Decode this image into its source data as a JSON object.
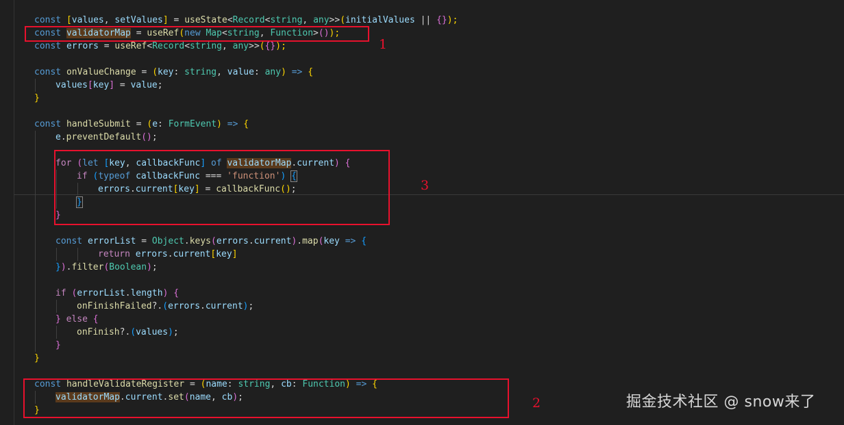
{
  "code_lines": [
    {
      "indent": 0,
      "tokens": [
        {
          "t": "const ",
          "c": "kw"
        },
        {
          "t": "[",
          "c": "p1"
        },
        {
          "t": "values",
          "c": "var"
        },
        {
          "t": ", ",
          "c": "op"
        },
        {
          "t": "setValues",
          "c": "var"
        },
        {
          "t": "]",
          "c": "p1"
        },
        {
          "t": " = ",
          "c": "op"
        },
        {
          "t": "useState",
          "c": "fn"
        },
        {
          "t": "<",
          "c": "op"
        },
        {
          "t": "Record",
          "c": "type"
        },
        {
          "t": "<",
          "c": "op"
        },
        {
          "t": "string",
          "c": "type"
        },
        {
          "t": ", ",
          "c": "op"
        },
        {
          "t": "any",
          "c": "type"
        },
        {
          "t": ">>",
          "c": "op"
        },
        {
          "t": "(",
          "c": "p1"
        },
        {
          "t": "initialValues",
          "c": "var"
        },
        {
          "t": " || ",
          "c": "op"
        },
        {
          "t": "{}",
          "c": "p2"
        },
        {
          "t": ");",
          "c": "p1"
        }
      ]
    },
    {
      "indent": 0,
      "tokens": [
        {
          "t": "const ",
          "c": "kw"
        },
        {
          "t": "validatorMap",
          "c": "var hl"
        },
        {
          "t": " = ",
          "c": "op"
        },
        {
          "t": "useRef",
          "c": "fn"
        },
        {
          "t": "(",
          "c": "p1"
        },
        {
          "t": "new ",
          "c": "kw"
        },
        {
          "t": "Map",
          "c": "type"
        },
        {
          "t": "<",
          "c": "op"
        },
        {
          "t": "string",
          "c": "type"
        },
        {
          "t": ", ",
          "c": "op"
        },
        {
          "t": "Function",
          "c": "type"
        },
        {
          "t": ">",
          "c": "op"
        },
        {
          "t": "()",
          "c": "p2"
        },
        {
          "t": ");",
          "c": "p1"
        }
      ]
    },
    {
      "indent": 0,
      "tokens": [
        {
          "t": "const ",
          "c": "kw"
        },
        {
          "t": "errors",
          "c": "var"
        },
        {
          "t": " = ",
          "c": "op"
        },
        {
          "t": "useRef",
          "c": "fn"
        },
        {
          "t": "<",
          "c": "op"
        },
        {
          "t": "Record",
          "c": "type"
        },
        {
          "t": "<",
          "c": "op"
        },
        {
          "t": "string",
          "c": "type"
        },
        {
          "t": ", ",
          "c": "op"
        },
        {
          "t": "any",
          "c": "type"
        },
        {
          "t": ">>",
          "c": "op"
        },
        {
          "t": "(",
          "c": "p1"
        },
        {
          "t": "{}",
          "c": "p2"
        },
        {
          "t": ");",
          "c": "p1"
        }
      ]
    },
    {
      "indent": 0,
      "tokens": []
    },
    {
      "indent": 0,
      "tokens": [
        {
          "t": "const ",
          "c": "kw"
        },
        {
          "t": "onValueChange",
          "c": "fn"
        },
        {
          "t": " = ",
          "c": "op"
        },
        {
          "t": "(",
          "c": "p1"
        },
        {
          "t": "key",
          "c": "var"
        },
        {
          "t": ": ",
          "c": "op"
        },
        {
          "t": "string",
          "c": "type"
        },
        {
          "t": ", ",
          "c": "op"
        },
        {
          "t": "value",
          "c": "var"
        },
        {
          "t": ": ",
          "c": "op"
        },
        {
          "t": "any",
          "c": "type"
        },
        {
          "t": ")",
          "c": "p1"
        },
        {
          "t": " => ",
          "c": "kw"
        },
        {
          "t": "{",
          "c": "p1"
        }
      ]
    },
    {
      "indent": 1,
      "tokens": [
        {
          "t": "values",
          "c": "var"
        },
        {
          "t": "[",
          "c": "p2"
        },
        {
          "t": "key",
          "c": "var"
        },
        {
          "t": "]",
          "c": "p2"
        },
        {
          "t": " = ",
          "c": "op"
        },
        {
          "t": "value",
          "c": "var"
        },
        {
          "t": ";",
          "c": "op"
        }
      ]
    },
    {
      "indent": 0,
      "tokens": [
        {
          "t": "}",
          "c": "p1"
        }
      ]
    },
    {
      "indent": 0,
      "tokens": []
    },
    {
      "indent": 0,
      "tokens": [
        {
          "t": "const ",
          "c": "kw"
        },
        {
          "t": "handleSubmit",
          "c": "fn"
        },
        {
          "t": " = ",
          "c": "op"
        },
        {
          "t": "(",
          "c": "p1"
        },
        {
          "t": "e",
          "c": "var"
        },
        {
          "t": ": ",
          "c": "op"
        },
        {
          "t": "FormEvent",
          "c": "type"
        },
        {
          "t": ")",
          "c": "p1"
        },
        {
          "t": " => ",
          "c": "kw"
        },
        {
          "t": "{",
          "c": "p1"
        }
      ]
    },
    {
      "indent": 1,
      "tokens": [
        {
          "t": "e",
          "c": "var"
        },
        {
          "t": ".",
          "c": "op"
        },
        {
          "t": "preventDefault",
          "c": "fn"
        },
        {
          "t": "()",
          "c": "p2"
        },
        {
          "t": ";",
          "c": "op"
        }
      ]
    },
    {
      "indent": 1,
      "tokens": []
    },
    {
      "indent": 1,
      "tokens": [
        {
          "t": "for ",
          "c": "ctrl"
        },
        {
          "t": "(",
          "c": "p2"
        },
        {
          "t": "let ",
          "c": "kw"
        },
        {
          "t": "[",
          "c": "p3"
        },
        {
          "t": "key",
          "c": "var"
        },
        {
          "t": ", ",
          "c": "op"
        },
        {
          "t": "callbackFunc",
          "c": "var"
        },
        {
          "t": "]",
          "c": "p3"
        },
        {
          "t": " of ",
          "c": "kw"
        },
        {
          "t": "validatorMap",
          "c": "var hl"
        },
        {
          "t": ".",
          "c": "op"
        },
        {
          "t": "current",
          "c": "var"
        },
        {
          "t": ")",
          "c": "p2"
        },
        {
          "t": " {",
          "c": "p2"
        }
      ]
    },
    {
      "indent": 2,
      "tokens": [
        {
          "t": "if ",
          "c": "ctrl"
        },
        {
          "t": "(",
          "c": "p3"
        },
        {
          "t": "typeof ",
          "c": "kw"
        },
        {
          "t": "callbackFunc",
          "c": "var"
        },
        {
          "t": " === ",
          "c": "op"
        },
        {
          "t": "'function'",
          "c": "str"
        },
        {
          "t": ")",
          "c": "p3"
        },
        {
          "t": " ",
          "c": "op"
        },
        {
          "t": "{",
          "c": "p3 hl-bracket"
        }
      ]
    },
    {
      "indent": 3,
      "tokens": [
        {
          "t": "errors",
          "c": "var"
        },
        {
          "t": ".",
          "c": "op"
        },
        {
          "t": "current",
          "c": "var"
        },
        {
          "t": "[",
          "c": "p1"
        },
        {
          "t": "key",
          "c": "var"
        },
        {
          "t": "]",
          "c": "p1"
        },
        {
          "t": " = ",
          "c": "op"
        },
        {
          "t": "callbackFunc",
          "c": "fn"
        },
        {
          "t": "()",
          "c": "p1"
        },
        {
          "t": ";",
          "c": "op"
        }
      ]
    },
    {
      "indent": 2,
      "tokens": [
        {
          "t": "}",
          "c": "p3 hl-bracket"
        }
      ]
    },
    {
      "indent": 1,
      "tokens": [
        {
          "t": "}",
          "c": "p2"
        }
      ]
    },
    {
      "indent": 1,
      "tokens": []
    },
    {
      "indent": 1,
      "tokens": [
        {
          "t": "const ",
          "c": "kw"
        },
        {
          "t": "errorList",
          "c": "var"
        },
        {
          "t": " = ",
          "c": "op"
        },
        {
          "t": "Object",
          "c": "type"
        },
        {
          "t": ".",
          "c": "op"
        },
        {
          "t": "keys",
          "c": "fn"
        },
        {
          "t": "(",
          "c": "p2"
        },
        {
          "t": "errors",
          "c": "var"
        },
        {
          "t": ".",
          "c": "op"
        },
        {
          "t": "current",
          "c": "var"
        },
        {
          "t": ")",
          "c": "p2"
        },
        {
          "t": ".",
          "c": "op"
        },
        {
          "t": "map",
          "c": "fn"
        },
        {
          "t": "(",
          "c": "p2"
        },
        {
          "t": "key",
          "c": "var"
        },
        {
          "t": " => ",
          "c": "kw"
        },
        {
          "t": "{",
          "c": "p3"
        }
      ]
    },
    {
      "indent": 3,
      "tokens": [
        {
          "t": "return ",
          "c": "ctrl"
        },
        {
          "t": "errors",
          "c": "var"
        },
        {
          "t": ".",
          "c": "op"
        },
        {
          "t": "current",
          "c": "var"
        },
        {
          "t": "[",
          "c": "p1"
        },
        {
          "t": "key",
          "c": "var"
        },
        {
          "t": "]",
          "c": "p1"
        }
      ]
    },
    {
      "indent": 1,
      "tokens": [
        {
          "t": "}",
          "c": "p3"
        },
        {
          "t": ")",
          "c": "p2"
        },
        {
          "t": ".",
          "c": "op"
        },
        {
          "t": "filter",
          "c": "fn"
        },
        {
          "t": "(",
          "c": "p2"
        },
        {
          "t": "Boolean",
          "c": "type"
        },
        {
          "t": ")",
          "c": "p2"
        },
        {
          "t": ";",
          "c": "op"
        }
      ]
    },
    {
      "indent": 1,
      "tokens": []
    },
    {
      "indent": 1,
      "tokens": [
        {
          "t": "if ",
          "c": "ctrl"
        },
        {
          "t": "(",
          "c": "p2"
        },
        {
          "t": "errorList",
          "c": "var"
        },
        {
          "t": ".",
          "c": "op"
        },
        {
          "t": "length",
          "c": "var"
        },
        {
          "t": ")",
          "c": "p2"
        },
        {
          "t": " {",
          "c": "p2"
        }
      ]
    },
    {
      "indent": 2,
      "tokens": [
        {
          "t": "onFinishFailed",
          "c": "fn"
        },
        {
          "t": "?.",
          "c": "op"
        },
        {
          "t": "(",
          "c": "p3"
        },
        {
          "t": "errors",
          "c": "var"
        },
        {
          "t": ".",
          "c": "op"
        },
        {
          "t": "current",
          "c": "var"
        },
        {
          "t": ")",
          "c": "p3"
        },
        {
          "t": ";",
          "c": "op"
        }
      ]
    },
    {
      "indent": 1,
      "tokens": [
        {
          "t": "} ",
          "c": "p2"
        },
        {
          "t": "else ",
          "c": "ctrl"
        },
        {
          "t": "{",
          "c": "p2"
        }
      ]
    },
    {
      "indent": 2,
      "tokens": [
        {
          "t": "onFinish",
          "c": "fn"
        },
        {
          "t": "?.",
          "c": "op"
        },
        {
          "t": "(",
          "c": "p3"
        },
        {
          "t": "values",
          "c": "var"
        },
        {
          "t": ")",
          "c": "p3"
        },
        {
          "t": ";",
          "c": "op"
        }
      ]
    },
    {
      "indent": 1,
      "tokens": [
        {
          "t": "}",
          "c": "p2"
        }
      ]
    },
    {
      "indent": 0,
      "tokens": [
        {
          "t": "}",
          "c": "p1"
        }
      ]
    },
    {
      "indent": 0,
      "tokens": []
    },
    {
      "indent": 0,
      "tokens": [
        {
          "t": "const ",
          "c": "kw"
        },
        {
          "t": "handleValidateRegister",
          "c": "fn"
        },
        {
          "t": " = ",
          "c": "op"
        },
        {
          "t": "(",
          "c": "p1"
        },
        {
          "t": "name",
          "c": "var"
        },
        {
          "t": ": ",
          "c": "op"
        },
        {
          "t": "string",
          "c": "type"
        },
        {
          "t": ", ",
          "c": "op"
        },
        {
          "t": "cb",
          "c": "var"
        },
        {
          "t": ": ",
          "c": "op"
        },
        {
          "t": "Function",
          "c": "type"
        },
        {
          "t": ")",
          "c": "p1"
        },
        {
          "t": " => ",
          "c": "kw"
        },
        {
          "t": "{",
          "c": "p1"
        }
      ]
    },
    {
      "indent": 1,
      "tokens": [
        {
          "t": "validatorMap",
          "c": "var hl"
        },
        {
          "t": ".",
          "c": "op"
        },
        {
          "t": "current",
          "c": "var"
        },
        {
          "t": ".",
          "c": "op"
        },
        {
          "t": "set",
          "c": "fn"
        },
        {
          "t": "(",
          "c": "p2"
        },
        {
          "t": "name",
          "c": "var"
        },
        {
          "t": ", ",
          "c": "op"
        },
        {
          "t": "cb",
          "c": "var"
        },
        {
          "t": ")",
          "c": "p2"
        },
        {
          "t": ";",
          "c": "op"
        }
      ]
    },
    {
      "indent": 0,
      "tokens": [
        {
          "t": "}",
          "c": "p1"
        }
      ]
    }
  ],
  "annotations": [
    {
      "label": "1"
    },
    {
      "label": "3"
    },
    {
      "label": "2"
    }
  ],
  "watermark": "掘金技术社区 @ snow来了",
  "colors": {
    "background": "#1f1f1f",
    "annotation": "#e8112d"
  }
}
